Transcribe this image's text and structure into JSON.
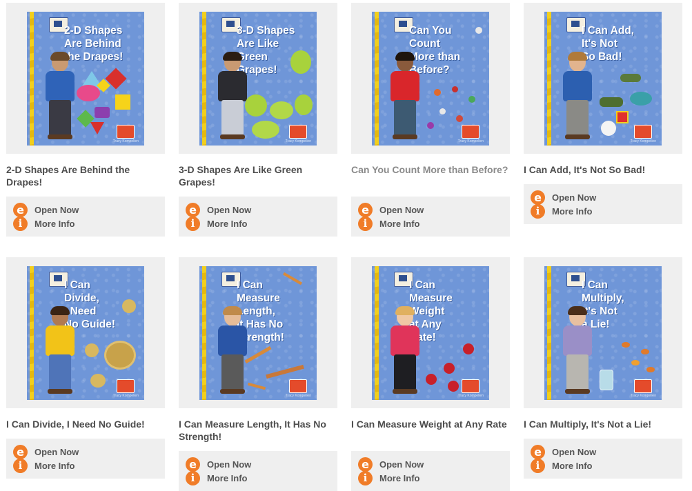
{
  "books": [
    {
      "cover_title": "2-D Shapes\nAre Behind\nthe Drapes!",
      "title": "2-D Shapes Are Behind the Drapes!",
      "open_label": "Open Now",
      "info_label": "More Info",
      "author": "Tracy Kompelien",
      "shirt_color": "#2f63b8",
      "pants_color": "#3a3a44",
      "muted": false
    },
    {
      "cover_title": "3-D Shapes\nAre Like\nGreen\nGrapes!",
      "title": "3-D Shapes Are Like Green Grapes!",
      "open_label": "Open Now",
      "info_label": "More Info",
      "author": "Tracy Kompelien",
      "shirt_color": "#2b2b30",
      "pants_color": "#c9cdd6",
      "muted": false
    },
    {
      "cover_title": "Can You\nCount\nMore than\nBefore?",
      "title": "Can You Count More than Before?",
      "open_label": "Open Now",
      "info_label": "More Info",
      "author": "Tracy Kompelien",
      "shirt_color": "#d9262b",
      "pants_color": "#3d5a72",
      "muted": true
    },
    {
      "cover_title": "I Can Add,\nIt's Not\nSo Bad!",
      "title": "I Can Add, It's Not So Bad!",
      "open_label": "Open Now",
      "info_label": "More Info",
      "author": "Tracy Kompelien",
      "shirt_color": "#2c5fb0",
      "pants_color": "#8a8a86",
      "muted": false
    },
    {
      "cover_title": "I Can\nDivide,\nI Need\nNo Guide!",
      "title": "I Can Divide, I Need No Guide!",
      "open_label": "Open Now",
      "info_label": "More Info",
      "author": "Tracy Kompelien",
      "shirt_color": "#f2c318",
      "pants_color": "#4f74b8",
      "muted": false
    },
    {
      "cover_title": "I Can\nMeasure\nLength,\nIt Has No\nStrength!",
      "title": "I Can Measure Length, It Has No Strength!",
      "open_label": "Open Now",
      "info_label": "More Info",
      "author": "Tracy Kompelien",
      "shirt_color": "#2a55a6",
      "pants_color": "#5a5a5a",
      "muted": false
    },
    {
      "cover_title": "I Can\nMeasure\nWeight\nat Any\nRate!",
      "title": "I Can Measure Weight at Any Rate",
      "open_label": "Open Now",
      "info_label": "More Info",
      "author": "Tracy Kompelien",
      "shirt_color": "#e0345a",
      "pants_color": "#1e1e22",
      "muted": false
    },
    {
      "cover_title": "I Can\nMultiply,\nIt's Not\na Lie!",
      "title": "I Can Multiply, It's Not a Lie!",
      "open_label": "Open Now",
      "info_label": "More Info",
      "author": "Tracy Kompelien",
      "shirt_color": "#9a8fc7",
      "pants_color": "#b8b6b0",
      "muted": false
    }
  ],
  "icons": {
    "open": "e",
    "info": "i"
  },
  "accent_color": "#f07c28"
}
